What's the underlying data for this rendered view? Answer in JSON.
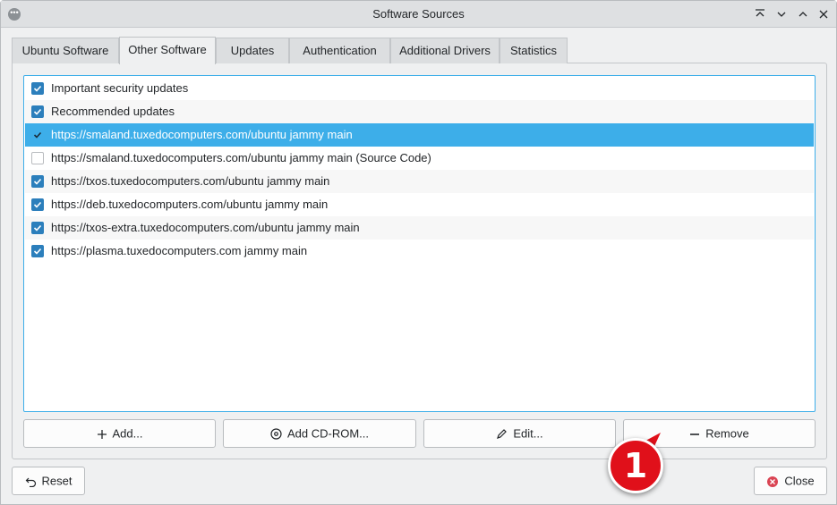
{
  "window": {
    "title": "Software Sources"
  },
  "tabs": [
    {
      "label": "Ubuntu Software",
      "active": false
    },
    {
      "label": "Other Software",
      "active": true
    },
    {
      "label": "Updates",
      "active": false
    },
    {
      "label": "Authentication",
      "active": false
    },
    {
      "label": "Additional Drivers",
      "active": false
    },
    {
      "label": "Statistics",
      "active": false
    }
  ],
  "sources": [
    {
      "label": "Important security updates",
      "checked": true,
      "selected": false
    },
    {
      "label": "Recommended updates",
      "checked": true,
      "selected": false
    },
    {
      "label": "https://smaland.tuxedocomputers.com/ubuntu jammy main",
      "checked": true,
      "selected": true
    },
    {
      "label": "https://smaland.tuxedocomputers.com/ubuntu jammy main (Source Code)",
      "checked": false,
      "selected": false
    },
    {
      "label": "https://txos.tuxedocomputers.com/ubuntu jammy main",
      "checked": true,
      "selected": false
    },
    {
      "label": "https://deb.tuxedocomputers.com/ubuntu jammy main",
      "checked": true,
      "selected": false
    },
    {
      "label": "https://txos-extra.tuxedocomputers.com/ubuntu jammy main",
      "checked": true,
      "selected": false
    },
    {
      "label": "https://plasma.tuxedocomputers.com jammy main",
      "checked": true,
      "selected": false
    }
  ],
  "actions": {
    "add": "Add...",
    "add_cdrom": "Add CD-ROM...",
    "edit": "Edit...",
    "remove": "Remove"
  },
  "footer": {
    "reset": "Reset",
    "close": "Close"
  },
  "annotation": {
    "badge_number": "1"
  },
  "colors": {
    "accent": "#3daee9",
    "checkbox": "#2c7fbc",
    "badge": "#e0101a"
  }
}
